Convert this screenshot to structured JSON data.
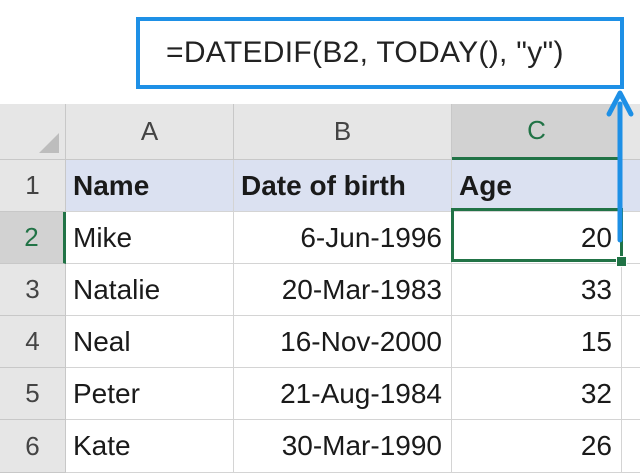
{
  "formula_bar": {
    "formula": "=DATEDIF(B2, TODAY(), \"y\")"
  },
  "columns": [
    "A",
    "B",
    "C"
  ],
  "rows": [
    "1",
    "2",
    "3",
    "4",
    "5",
    "6"
  ],
  "headers": {
    "name": "Name",
    "dob": "Date of birth",
    "age": "Age"
  },
  "data": [
    {
      "name": "Mike",
      "dob": "6-Jun-1996",
      "age": "20"
    },
    {
      "name": "Natalie",
      "dob": "20-Mar-1983",
      "age": "33"
    },
    {
      "name": "Neal",
      "dob": "16-Nov-2000",
      "age": "15"
    },
    {
      "name": "Peter",
      "dob": "21-Aug-1984",
      "age": "32"
    },
    {
      "name": "Kate",
      "dob": "30-Mar-1990",
      "age": "26"
    }
  ],
  "selected_cell": "C2",
  "colors": {
    "accent": "#1e90e6",
    "selection": "#217346",
    "header_fill": "#dbe1f1"
  }
}
